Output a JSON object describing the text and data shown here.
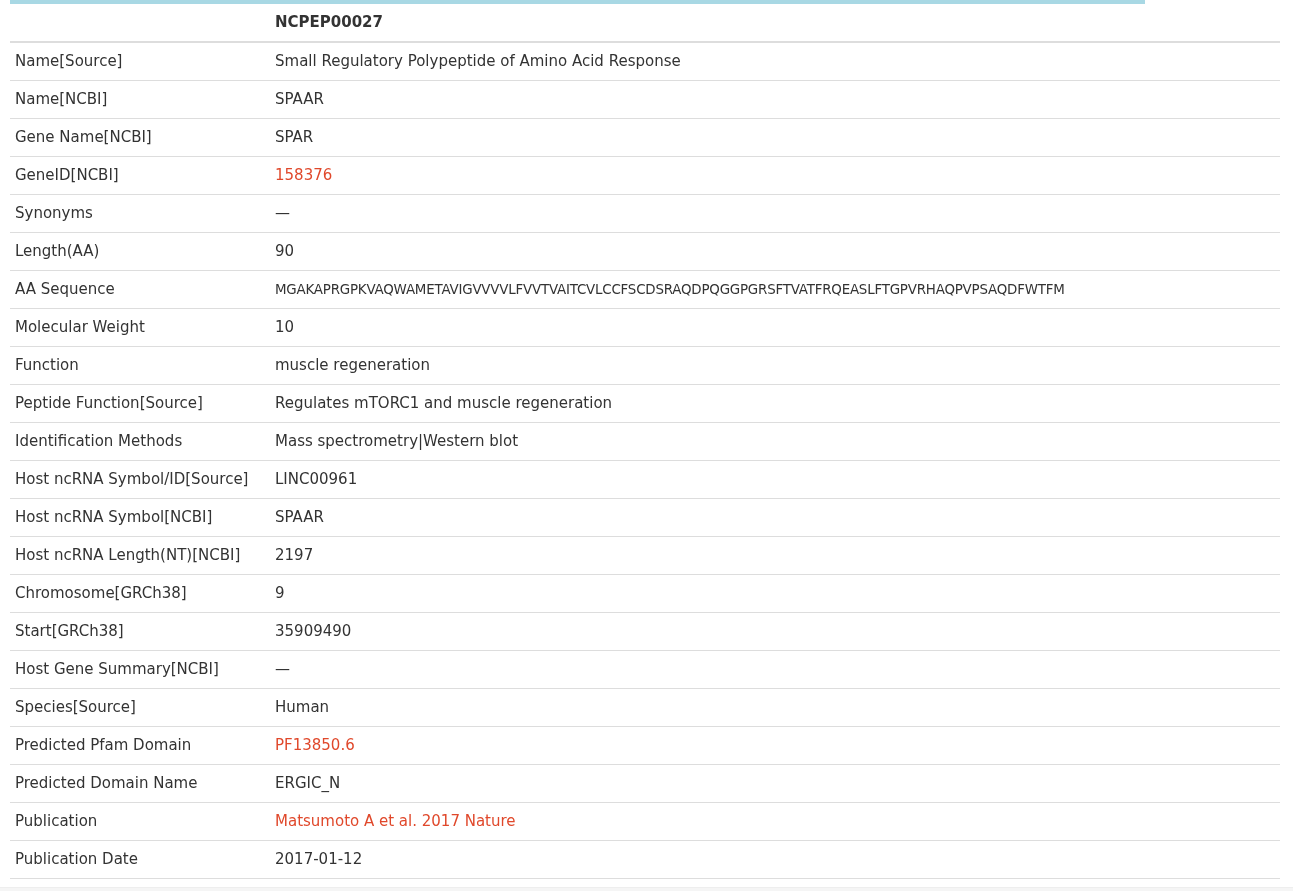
{
  "header": {
    "id": "NCPEP00027"
  },
  "rows": [
    {
      "label": "Name[Source]",
      "value": "Small Regulatory Polypeptide of Amino Acid Response",
      "kind": "text"
    },
    {
      "label": "Name[NCBI]",
      "value": "SPAAR",
      "kind": "text"
    },
    {
      "label": "Gene Name[NCBI]",
      "value": "SPAR",
      "kind": "text"
    },
    {
      "label": "GeneID[NCBI]",
      "value": "158376",
      "kind": "link"
    },
    {
      "label": "Synonyms",
      "value": "—",
      "kind": "text"
    },
    {
      "label": "Length(AA)",
      "value": "90",
      "kind": "text"
    },
    {
      "label": "AA Sequence",
      "value": "MGAKAPRGPKVAQWAMETAVIGVVVVLFVVTVAITCVLCCFSCDSRAQDPQGGPGRSFTVATFRQEASLFTGPVRHAQPVPSAQDFWTFM",
      "kind": "sequence"
    },
    {
      "label": "Molecular Weight",
      "value": "10",
      "kind": "text"
    },
    {
      "label": "Function",
      "value": "muscle regeneration",
      "kind": "text"
    },
    {
      "label": "Peptide Function[Source]",
      "value": "Regulates mTORC1 and muscle regeneration",
      "kind": "text"
    },
    {
      "label": "Identification Methods",
      "value": "Mass spectrometry|Western blot",
      "kind": "text"
    },
    {
      "label": "Host ncRNA Symbol/ID[Source]",
      "value": "LINC00961",
      "kind": "text"
    },
    {
      "label": "Host ncRNA Symbol[NCBI]",
      "value": "SPAAR",
      "kind": "text"
    },
    {
      "label": "Host ncRNA Length(NT)[NCBI]",
      "value": "2197",
      "kind": "text"
    },
    {
      "label": "Chromosome[GRCh38]",
      "value": "9",
      "kind": "text"
    },
    {
      "label": "Start[GRCh38]",
      "value": "35909490",
      "kind": "text"
    },
    {
      "label": "Host Gene Summary[NCBI]",
      "value": "—",
      "kind": "text"
    },
    {
      "label": "Species[Source]",
      "value": "Human",
      "kind": "text"
    },
    {
      "label": "Predicted Pfam Domain",
      "value": "PF13850.6",
      "kind": "link"
    },
    {
      "label": "Predicted Domain Name",
      "value": "ERGIC_N",
      "kind": "text"
    },
    {
      "label": "Publication",
      "value": "Matsumoto A et al. 2017 Nature",
      "kind": "link"
    },
    {
      "label": "Publication Date",
      "value": "2017-01-12",
      "kind": "text"
    }
  ]
}
